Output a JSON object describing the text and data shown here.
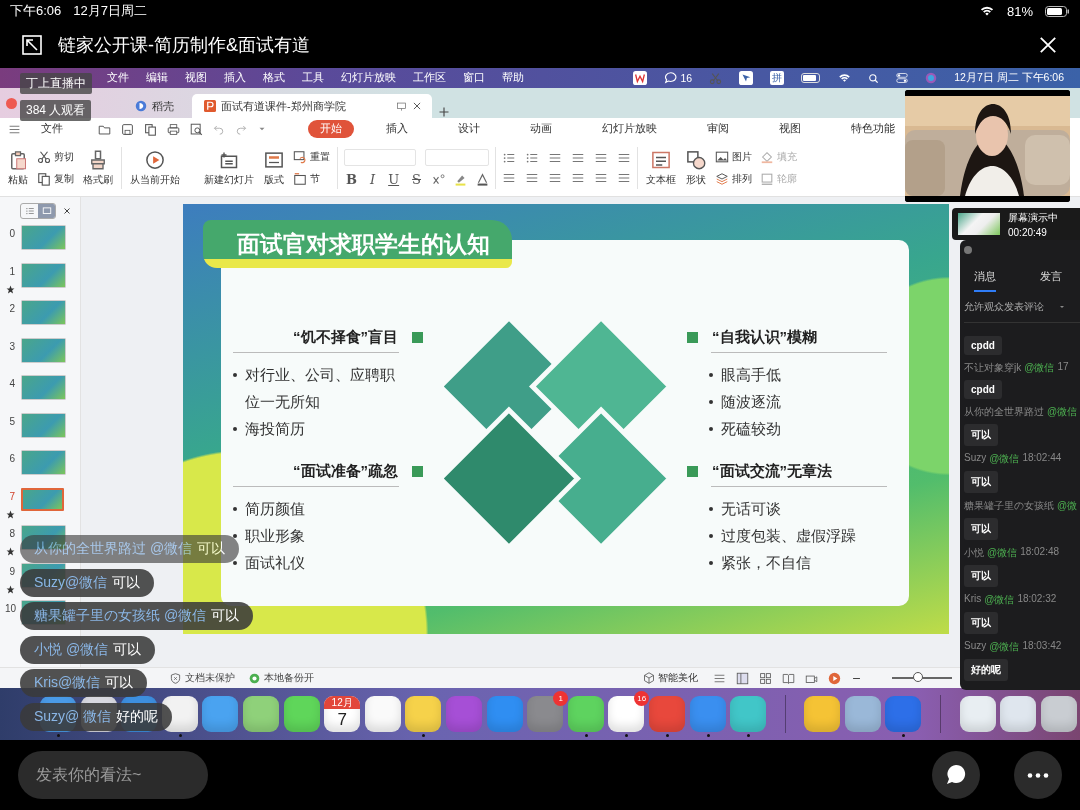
{
  "ipad_status": {
    "time": "下午6:06",
    "date": "12月7日周二",
    "battery": "81%"
  },
  "title": "链家公开课-简历制作&面试有道",
  "live": {
    "status": "丁上直播中",
    "viewers": "384 人观看"
  },
  "mac_menu": {
    "items": [
      "文件",
      "编辑",
      "视图",
      "插入",
      "格式",
      "工具",
      "幻灯片放映",
      "工作区",
      "窗口",
      "帮助"
    ],
    "chat_count": "16",
    "ime": "拼",
    "clock": "12月7日 周二 下午6:06"
  },
  "tabs": [
    {
      "label": "稻壳",
      "selected": false
    },
    {
      "label": "面试有道课件-郑州商学院",
      "selected": true
    }
  ],
  "file_menu": "文件",
  "ribbon_tabs": [
    {
      "label": "开始",
      "selected": true
    },
    {
      "label": "插入",
      "selected": false
    },
    {
      "label": "设计",
      "selected": false
    },
    {
      "label": "动画",
      "selected": false
    },
    {
      "label": "幻灯片放映",
      "selected": false
    },
    {
      "label": "审阅",
      "selected": false
    },
    {
      "label": "视图",
      "selected": false
    },
    {
      "label": "特色功能",
      "selected": false
    }
  ],
  "toolbar": {
    "paste": "粘贴",
    "cut": "剪切",
    "copy": "复制",
    "brush": "格式刷",
    "play": "从当前开始",
    "new_slide": "新建幻灯片",
    "layout": "版式",
    "reset": "重置",
    "section": "节",
    "format_letters": [
      "B",
      "I",
      "U",
      "S"
    ],
    "text_box": "文本框",
    "shape": "形状",
    "picture": "图片",
    "arrange": "排列",
    "fill": {
      "label": "填充",
      "disabled": true
    },
    "outline": {
      "label": "轮廓",
      "disabled": true
    }
  },
  "panel_views": [
    {
      "selected": false
    },
    {
      "selected": true
    }
  ],
  "slides": [
    {
      "number": "0",
      "selected": false,
      "starred": false
    },
    {
      "number": "1",
      "selected": false,
      "starred": true
    },
    {
      "number": "2",
      "selected": false,
      "starred": false
    },
    {
      "number": "3",
      "selected": false,
      "starred": false
    },
    {
      "number": "4",
      "selected": false,
      "starred": false
    },
    {
      "number": "5",
      "selected": false,
      "starred": false
    },
    {
      "number": "6",
      "selected": false,
      "starred": false
    },
    {
      "number": "7",
      "selected": true,
      "starred": true
    },
    {
      "number": "8",
      "selected": false,
      "starred": true
    },
    {
      "number": "9",
      "selected": false,
      "starred": true
    },
    {
      "number": "10",
      "selected": false,
      "starred": false
    }
  ],
  "slide": {
    "title": "面试官对求职学生的认知",
    "quadrants": [
      {
        "heading": "“饥不择食”盲目",
        "bullets": [
          "对行业、公司、应聘职位一无所知",
          "海投简历"
        ]
      },
      {
        "heading": "“自我认识”模糊",
        "bullets": [
          "眼高手低",
          "随波逐流",
          "死磕较劲"
        ]
      },
      {
        "heading": "“面试准备”疏忽",
        "bullets": [
          "简历颜值",
          "职业形象",
          "面试礼仪"
        ]
      },
      {
        "heading": "“面试交流”无章法",
        "bullets": [
          "无话可谈",
          "过度包装、虚假浮躁",
          "紧张，不自信"
        ]
      }
    ]
  },
  "status_bar": {
    "protect": "文档未保护",
    "backup": "本地备份开",
    "beautify": "智能美化",
    "zoom": {
      "level": 0.45
    }
  },
  "dock": [
    {
      "kind": "app",
      "color": "#4a9be8",
      "running": true
    },
    {
      "kind": "app",
      "color": "#d8d8e0",
      "running": false
    },
    {
      "kind": "app",
      "color": "#3d8fe0",
      "running": false
    },
    {
      "kind": "app",
      "color": "#f2f2f2",
      "running": true
    },
    {
      "kind": "app",
      "color": "#4aa3f0",
      "running": false
    },
    {
      "kind": "app",
      "color": "#8fd17a",
      "running": false
    },
    {
      "kind": "app",
      "color": "#5fd65a",
      "running": false
    },
    {
      "kind": "calendar",
      "month": "12月",
      "day": "7",
      "running": false
    },
    {
      "kind": "app",
      "color": "#fafafa",
      "running": false
    },
    {
      "kind": "app",
      "color": "#f6d24a",
      "running": true
    },
    {
      "kind": "app",
      "color": "#a64fd6",
      "running": false
    },
    {
      "kind": "app",
      "color": "#2f8ef2",
      "running": false
    },
    {
      "kind": "app",
      "color": "#8a8a8e",
      "running": false,
      "badge": "1"
    },
    {
      "kind": "app",
      "color": "#5ed35f",
      "running": true
    },
    {
      "kind": "app",
      "color": "#ffffff",
      "running": true,
      "badge": "16"
    },
    {
      "kind": "app",
      "color": "#e8483c",
      "running": true
    },
    {
      "kind": "app",
      "color": "#3a8ff0",
      "running": true
    },
    {
      "kind": "app",
      "color": "#41c6c8",
      "running": true
    },
    {
      "kind": "divider"
    },
    {
      "kind": "app",
      "color": "#f5c335",
      "running": false
    },
    {
      "kind": "app",
      "color": "#9ab8d8",
      "running": false
    },
    {
      "kind": "app",
      "color": "#2d6fe8",
      "running": true
    },
    {
      "kind": "divider"
    },
    {
      "kind": "app",
      "color": "#e8eef2",
      "running": false
    },
    {
      "kind": "app",
      "color": "#dfe6ee",
      "running": false
    },
    {
      "kind": "app",
      "color": "#c9cdd2",
      "running": false
    }
  ],
  "presenting": {
    "label": "屏幕演示中",
    "elapsed": "00:20:49"
  },
  "chat_tabs": [
    {
      "label": "消息",
      "selected": true
    },
    {
      "label": "发言",
      "selected": false
    }
  ],
  "comment_setting": "允许观众发表评论",
  "messages": [
    {
      "text": "cpdd"
    },
    {
      "user": "不让对象穿jk",
      "source": "@微信",
      "time": "17",
      "text": "cpdd"
    },
    {
      "user": "从你的全世界路过",
      "source": "@微信",
      "text": "可以"
    },
    {
      "user": "Suzy",
      "source": "@微信",
      "time": "18:02:44",
      "text": "可以"
    },
    {
      "user": "糖果罐子里の女孩纸",
      "source": "@微",
      "text": "可以"
    },
    {
      "user": "小悦",
      "source": "@微信",
      "time": "18:02:48",
      "text": "可以"
    },
    {
      "user": "Kris",
      "source": "@微信",
      "time": "18:02:32",
      "text": "可以"
    },
    {
      "user": "Suzy",
      "source": "@微信",
      "time": "18:03:42",
      "text": "好的呢"
    }
  ],
  "bubbles": [
    {
      "user": "从你的全世界路过 @微信",
      "text": "可以",
      "faded": true
    },
    {
      "user": "Suzy@微信",
      "text": "可以",
      "faded": false
    },
    {
      "user": "糖果罐子里の女孩纸 @微信",
      "text": "可以",
      "faded": false
    },
    {
      "user": "小悦 @微信",
      "text": "可以",
      "faded": false
    },
    {
      "user": "Kris@微信",
      "text": "可以",
      "faded": false
    },
    {
      "user": "Suzy@ 微信",
      "text": "好的呢",
      "faded": false
    }
  ],
  "comment_box": {
    "placeholder": "发表你的看法~"
  }
}
